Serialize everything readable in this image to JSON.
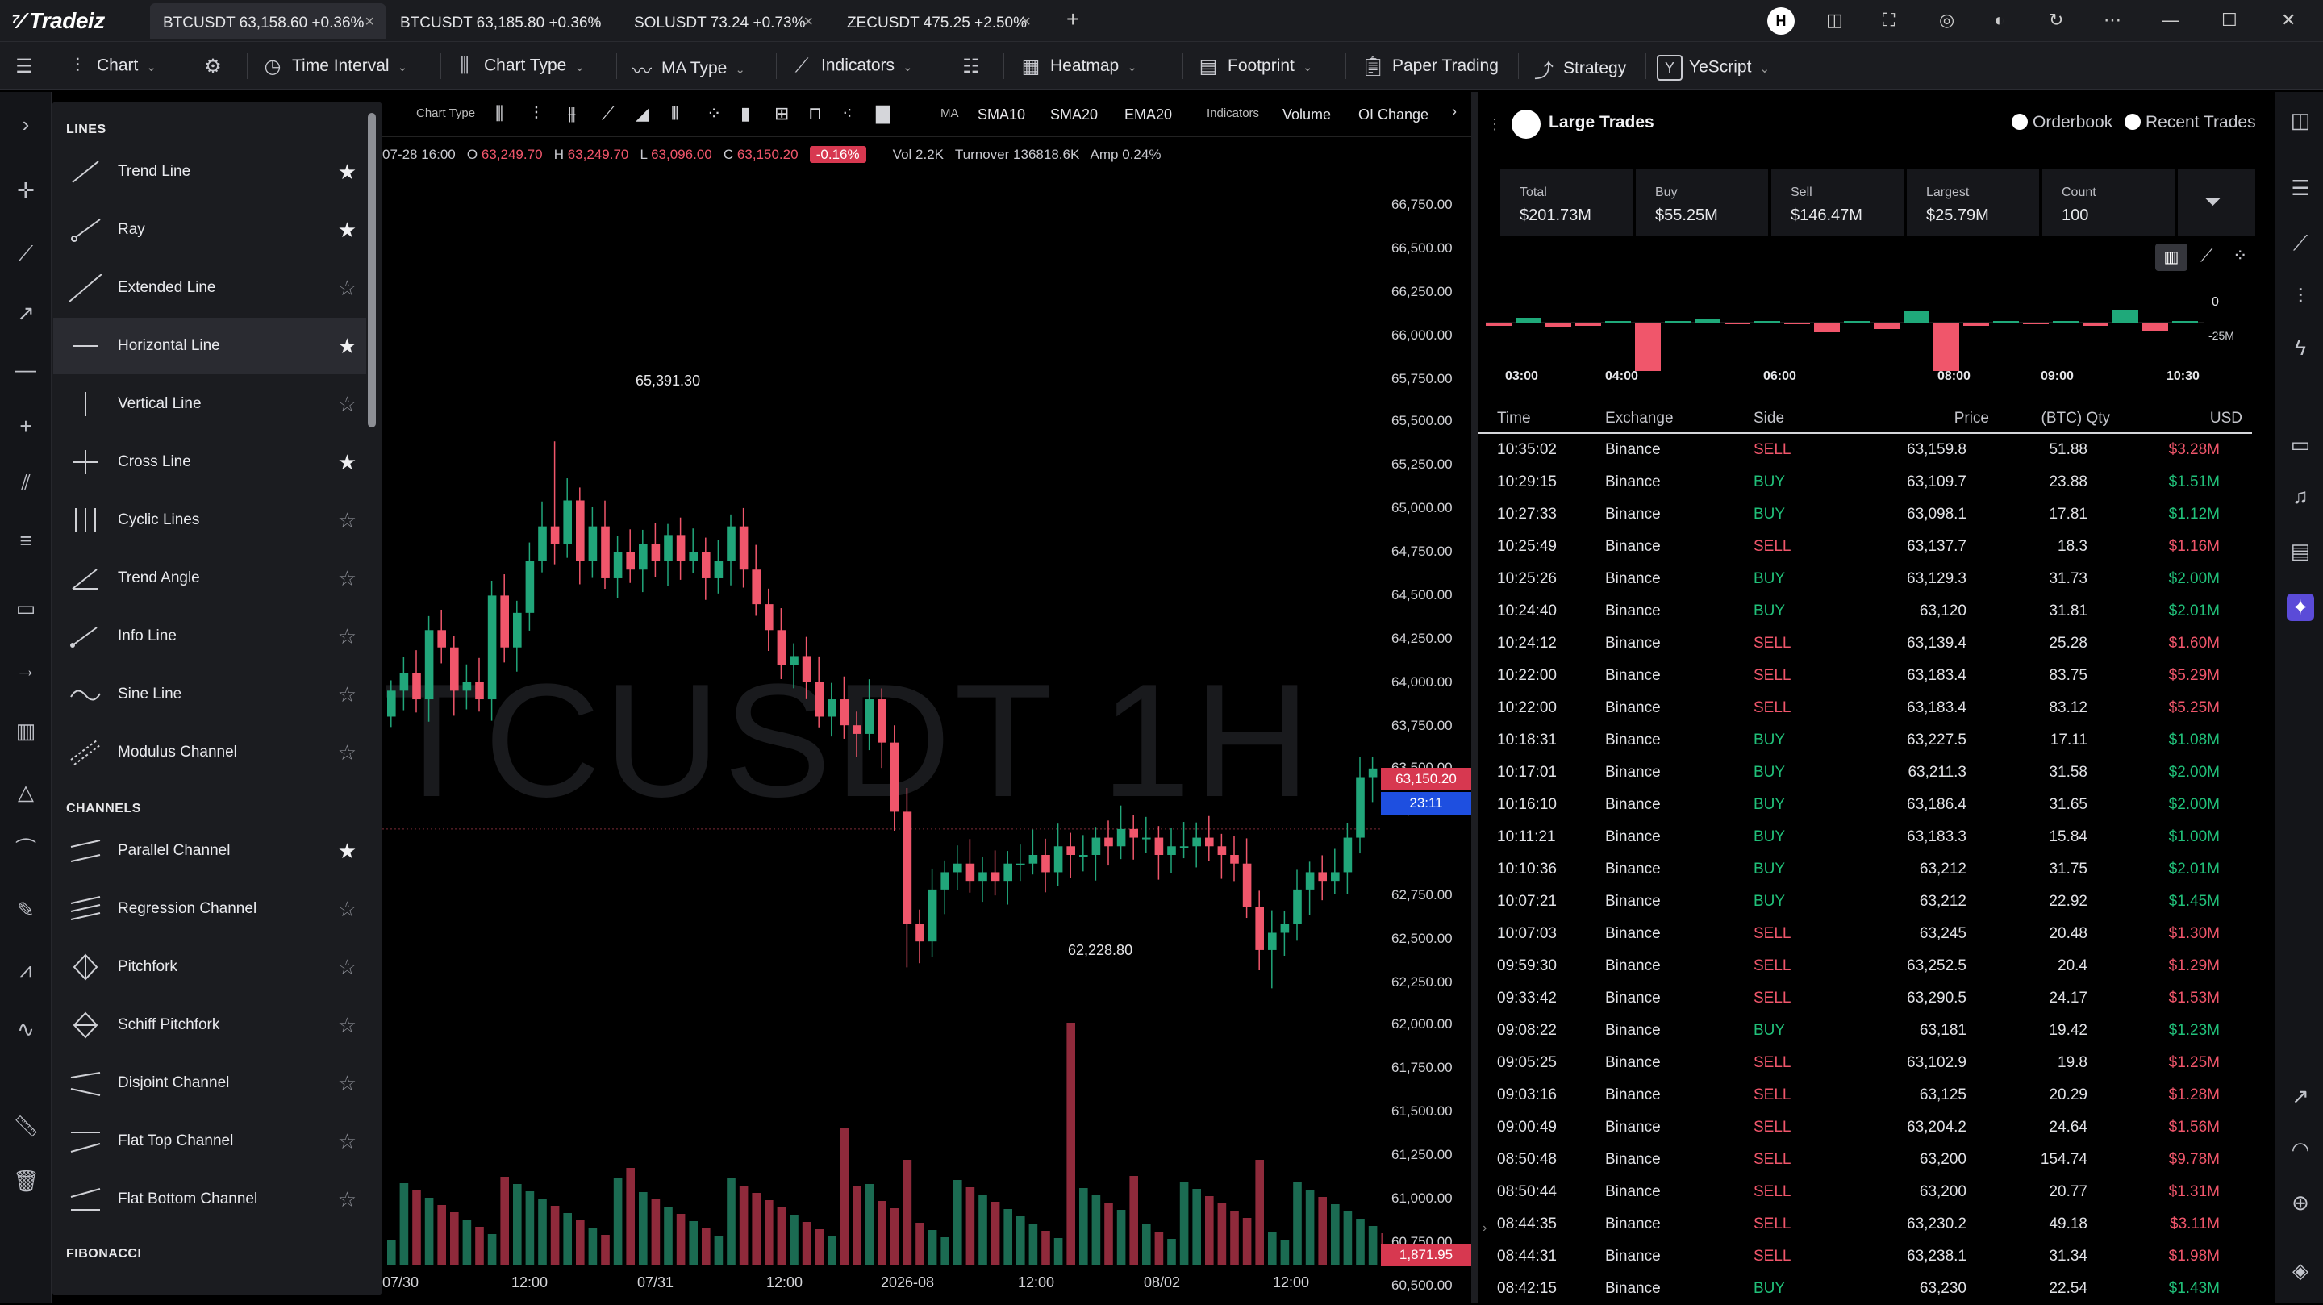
{
  "app": {
    "name": "Tradeiz"
  },
  "tabs": [
    {
      "label": "BTCUSDT 63,158.60 +0.36%",
      "active": true
    },
    {
      "label": "BTCUSDT 63,185.80 +0.36%",
      "active": false
    },
    {
      "label": "SOLUSDT 73.24 +0.73%",
      "active": false
    },
    {
      "label": "ZECUSDT 475.25 +2.50%",
      "active": false
    }
  ],
  "user": {
    "avatar_letter": "H"
  },
  "toolbar": {
    "chart": "Chart",
    "time_interval": "Time Interval",
    "chart_type": "Chart Type",
    "ma_type": "MA Type",
    "indicators": "Indicators",
    "heatmap": "Heatmap",
    "footprint": "Footprint",
    "paper_trading": "Paper Trading",
    "strategy": "Strategy",
    "yescript": "YeScript"
  },
  "drawing_panel": {
    "sections": [
      "LINES",
      "CHANNELS",
      "FIBONACCI"
    ],
    "lines": [
      {
        "label": "Trend Line",
        "starred": true
      },
      {
        "label": "Ray",
        "starred": true
      },
      {
        "label": "Extended Line",
        "starred": false
      },
      {
        "label": "Horizontal Line",
        "starred": true
      },
      {
        "label": "Vertical Line",
        "starred": false
      },
      {
        "label": "Cross Line",
        "starred": true
      },
      {
        "label": "Cyclic Lines",
        "starred": false
      },
      {
        "label": "Trend Angle",
        "starred": false
      },
      {
        "label": "Info Line",
        "starred": false
      },
      {
        "label": "Sine Line",
        "starred": false
      },
      {
        "label": "Modulus Channel",
        "starred": false
      }
    ],
    "channels": [
      {
        "label": "Parallel Channel",
        "starred": true
      },
      {
        "label": "Regression Channel",
        "starred": false
      },
      {
        "label": "Pitchfork",
        "starred": false
      },
      {
        "label": "Schiff Pitchfork",
        "starred": false
      },
      {
        "label": "Disjoint Channel",
        "starred": false
      },
      {
        "label": "Flat Top Channel",
        "starred": false
      },
      {
        "label": "Flat Bottom Channel",
        "starred": false
      }
    ]
  },
  "chart_bar": {
    "chart_type_label": "Chart Type",
    "ma_label": "MA",
    "sma10": "SMA10",
    "sma20": "SMA20",
    "ema20": "EMA20",
    "indicators_label": "Indicators",
    "volume": "Volume",
    "oi_change": "OI Change"
  },
  "ohlc": {
    "date": "07-28 16:00",
    "o_label": "O",
    "o": "63,249.70",
    "h_label": "H",
    "h": "63,249.70",
    "l_label": "L",
    "l": "63,096.00",
    "c_label": "C",
    "c": "63,150.20",
    "change": "-0.16%",
    "vol_label": "Vol",
    "vol": "2.2K",
    "turnover_label": "Turnover",
    "turnover": "136818.6K",
    "amp_label": "Amp",
    "amp": "0.24%"
  },
  "watermark": "TCUSDT 1H",
  "chart_annotations": {
    "high": "65,391.30",
    "low": "62,228.80"
  },
  "y_ticks": [
    "66,750.00",
    "66,500.00",
    "66,250.00",
    "66,000.00",
    "65,750.00",
    "65,500.00",
    "65,250.00",
    "65,000.00",
    "64,750.00",
    "64,500.00",
    "64,250.00",
    "64,000.00",
    "63,750.00",
    "63,500.00",
    "63,250.00",
    "62,750.00",
    "62,500.00",
    "62,250.00",
    "62,000.00",
    "61,750.00",
    "61,500.00",
    "61,250.00",
    "61,000.00",
    "60,750.00",
    "60,500.00"
  ],
  "x_ticks": [
    "07/30",
    "12:00",
    "07/31",
    "12:00",
    "2026-08",
    "12:00",
    "08/02",
    "12:00"
  ],
  "current_price": "63,150.20",
  "countdown": "23:11",
  "volume_value": "1,871.95",
  "colors": {
    "up": "#21a67a",
    "down": "#f0566b",
    "up_vol": "#1b6b52",
    "down_vol": "#8f2a3b"
  },
  "large_trades": {
    "title": "Large Trades",
    "orderbook": "Orderbook",
    "recent_trades": "Recent Trades",
    "stats": [
      {
        "k": "Total",
        "v": "$201.73M",
        "c": "neutral"
      },
      {
        "k": "Buy",
        "v": "$55.25M",
        "c": "buy"
      },
      {
        "k": "Sell",
        "v": "$146.47M",
        "c": "sell"
      },
      {
        "k": "Largest",
        "v": "$25.79M",
        "c": "neutral"
      },
      {
        "k": "Count",
        "v": "100",
        "c": "neutral"
      }
    ],
    "mini_chart": {
      "zero_label": "0",
      "neg_label": "-25M",
      "x_labels": [
        "03:00",
        "04:00",
        "06:00",
        "08:00",
        "09:00",
        "10:30"
      ]
    },
    "columns": [
      "Time",
      "Exchange",
      "Side",
      "Price",
      "(BTC) Qty",
      "USD"
    ],
    "rows": [
      [
        "10:35:02",
        "Binance",
        "SELL",
        "63,159.8",
        "51.88",
        "$3.28M"
      ],
      [
        "10:29:15",
        "Binance",
        "BUY",
        "63,109.7",
        "23.88",
        "$1.51M"
      ],
      [
        "10:27:33",
        "Binance",
        "BUY",
        "63,098.1",
        "17.81",
        "$1.12M"
      ],
      [
        "10:25:49",
        "Binance",
        "SELL",
        "63,137.7",
        "18.3",
        "$1.16M"
      ],
      [
        "10:25:26",
        "Binance",
        "BUY",
        "63,129.3",
        "31.73",
        "$2.00M"
      ],
      [
        "10:24:40",
        "Binance",
        "BUY",
        "63,120",
        "31.81",
        "$2.01M"
      ],
      [
        "10:24:12",
        "Binance",
        "SELL",
        "63,139.4",
        "25.28",
        "$1.60M"
      ],
      [
        "10:22:00",
        "Binance",
        "SELL",
        "63,183.4",
        "83.75",
        "$5.29M"
      ],
      [
        "10:22:00",
        "Binance",
        "SELL",
        "63,183.4",
        "83.12",
        "$5.25M"
      ],
      [
        "10:18:31",
        "Binance",
        "BUY",
        "63,227.5",
        "17.11",
        "$1.08M"
      ],
      [
        "10:17:01",
        "Binance",
        "BUY",
        "63,211.3",
        "31.58",
        "$2.00M"
      ],
      [
        "10:16:10",
        "Binance",
        "BUY",
        "63,186.4",
        "31.65",
        "$2.00M"
      ],
      [
        "10:11:21",
        "Binance",
        "BUY",
        "63,183.3",
        "15.84",
        "$1.00M"
      ],
      [
        "10:10:36",
        "Binance",
        "BUY",
        "63,212",
        "31.75",
        "$2.01M"
      ],
      [
        "10:07:21",
        "Binance",
        "BUY",
        "63,212",
        "22.92",
        "$1.45M"
      ],
      [
        "10:07:03",
        "Binance",
        "SELL",
        "63,245",
        "20.48",
        "$1.30M"
      ],
      [
        "09:59:30",
        "Binance",
        "SELL",
        "63,252.5",
        "20.4",
        "$1.29M"
      ],
      [
        "09:33:42",
        "Binance",
        "SELL",
        "63,290.5",
        "24.17",
        "$1.53M"
      ],
      [
        "09:08:22",
        "Binance",
        "BUY",
        "63,181",
        "19.42",
        "$1.23M"
      ],
      [
        "09:05:25",
        "Binance",
        "SELL",
        "63,102.9",
        "19.8",
        "$1.25M"
      ],
      [
        "09:03:16",
        "Binance",
        "SELL",
        "63,125",
        "20.29",
        "$1.28M"
      ],
      [
        "09:00:49",
        "Binance",
        "SELL",
        "63,204.2",
        "24.64",
        "$1.56M"
      ],
      [
        "08:50:48",
        "Binance",
        "SELL",
        "63,200",
        "154.74",
        "$9.78M"
      ],
      [
        "08:50:44",
        "Binance",
        "SELL",
        "63,200",
        "20.77",
        "$1.31M"
      ],
      [
        "08:44:35",
        "Binance",
        "SELL",
        "63,230.2",
        "49.18",
        "$3.11M"
      ],
      [
        "08:44:31",
        "Binance",
        "SELL",
        "63,238.1",
        "31.34",
        "$1.98M"
      ],
      [
        "08:42:15",
        "Binance",
        "BUY",
        "63,230",
        "22.54",
        "$1.43M"
      ]
    ]
  }
}
